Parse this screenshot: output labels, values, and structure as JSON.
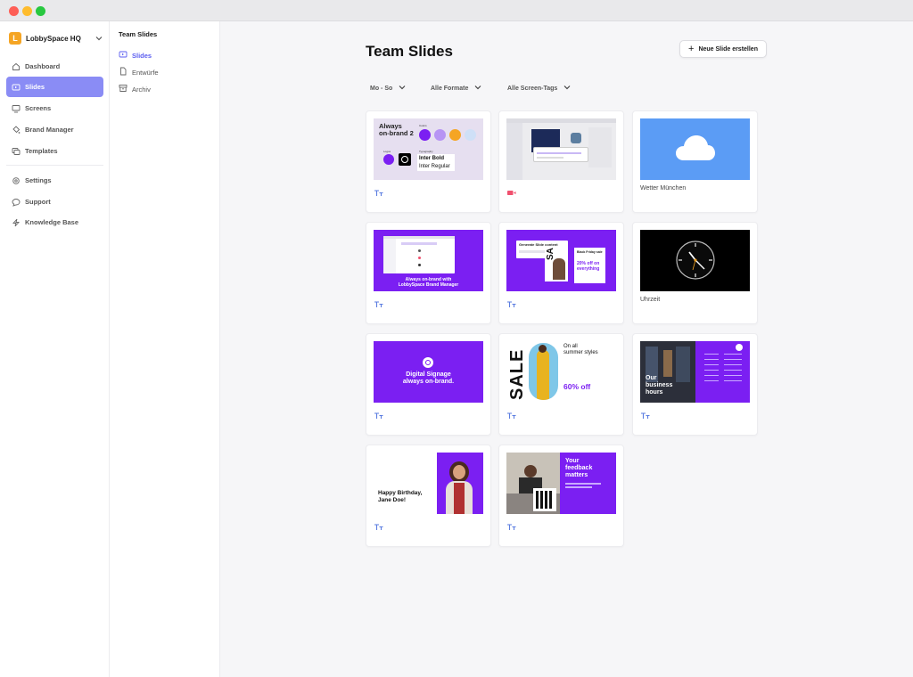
{
  "workspace": {
    "initial": "L",
    "name": "LobbySpace HQ"
  },
  "nav": [
    {
      "label": "Dashboard",
      "icon": "home-icon"
    },
    {
      "label": "Slides",
      "icon": "slides-icon",
      "active": true
    },
    {
      "label": "Screens",
      "icon": "monitor-icon"
    },
    {
      "label": "Brand Manager",
      "icon": "paint-bucket-icon"
    },
    {
      "label": "Templates",
      "icon": "templates-icon"
    },
    {
      "label": "Settings",
      "icon": "gear-icon"
    },
    {
      "label": "Support",
      "icon": "chat-bubble-icon"
    },
    {
      "label": "Knowledge Base",
      "icon": "lightning-icon"
    }
  ],
  "subnav": {
    "title": "Team Slides",
    "items": [
      {
        "label": "Slides",
        "icon": "slides-icon",
        "active": true
      },
      {
        "label": "Entwürfe",
        "icon": "document-icon"
      },
      {
        "label": "Archiv",
        "icon": "archive-icon"
      }
    ]
  },
  "main": {
    "title": "Team Slides",
    "new_button": "Neue Slide erstellen",
    "filters": [
      "Mo - So",
      "Alle Formate",
      "Alle Screen-Tags"
    ]
  },
  "cards": [
    {
      "kind": "brand",
      "label": "",
      "icon": "text-type-icon",
      "text": {
        "title1": "Always",
        "title2": "on-brand 2",
        "colors": "Colors",
        "logos": "Logos",
        "typo": "Typography",
        "bold": "Inter Bold",
        "regular": "Inter Regular"
      }
    },
    {
      "kind": "video",
      "label": "",
      "icon": "video-icon"
    },
    {
      "kind": "weather",
      "label": "Wetter München",
      "icon": ""
    },
    {
      "kind": "brandmanager",
      "label": "",
      "icon": "text-type-icon",
      "text": {
        "line1": "Always on-brand with",
        "line2": "LobbySpace Brand Manager"
      }
    },
    {
      "kind": "ai",
      "label": "",
      "icon": "text-type-icon",
      "text": {
        "gen": "Generate Slide content",
        "bf": "Black Friday sale",
        "off1": "20% off on",
        "off2": "everything"
      }
    },
    {
      "kind": "clock",
      "label": "Uhrzeit",
      "icon": ""
    },
    {
      "kind": "signage",
      "label": "",
      "icon": "text-type-icon",
      "text": {
        "line1": "Digital Signage",
        "line2": "always on-brand."
      }
    },
    {
      "kind": "sale",
      "label": "",
      "icon": "text-type-icon",
      "text": {
        "sale": "SALE",
        "on1": "On all",
        "on2": "summer styles",
        "off": "60% off"
      }
    },
    {
      "kind": "hours",
      "label": "",
      "icon": "text-type-icon",
      "text": {
        "line1": "Our",
        "line2": "business",
        "line3": "hours"
      }
    },
    {
      "kind": "birthday",
      "label": "",
      "icon": "text-type-icon",
      "text": {
        "line1": "Happy Birthday,",
        "line2": "Jane Doe!"
      }
    },
    {
      "kind": "feedback",
      "label": "",
      "icon": "text-type-icon",
      "text": {
        "line1": "Your",
        "line2": "feedback",
        "line3": "matters"
      }
    }
  ],
  "colors": {
    "accent": "#8a8cf5",
    "purple": "#7b1ff2",
    "sky": "#5b9cf5"
  }
}
